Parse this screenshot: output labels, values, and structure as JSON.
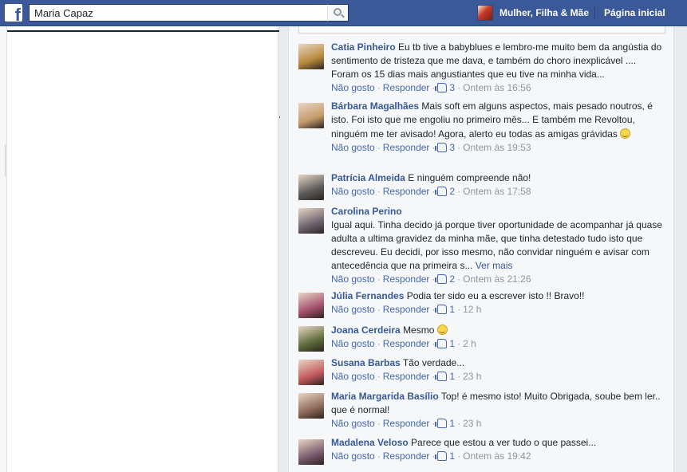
{
  "header": {
    "search_value": "Maria Capaz",
    "page_name": "Mulher, Filha & Mãe",
    "home_label": "Página inicial"
  },
  "actions": {
    "dislike": "Não gosto",
    "reply": "Responder"
  },
  "comments": [
    {
      "author": "Catia Pinheiro",
      "text": "Eu tb tive a babyblues e lembro-me muito bem da angústia do sentimento de tristeza que me dava, e também do choro inexplicável .... Foram os 15 dias mais angustiantes que eu tive na minha vida...",
      "likes": "3",
      "time": "Ontem às 16:56",
      "avatar_color": "#b8893d"
    },
    {
      "author": "Bárbara Magalhães",
      "text": "Mais soft em alguns aspectos, mais pesado noutros, é isto. Foi isto que me engoliu no primeiro mês... E também me Revoltou, ninguém me ter avisado! Agora, alerto eu todas as amigas grávidas",
      "likes": "3",
      "time": "Ontem às 19:53",
      "avatar_color": "#c49a6c"
    },
    {
      "author": "Patrícia Almeida",
      "text": "E ninguém compreende não!",
      "likes": "2",
      "time": "Ontem às 17:58",
      "avatar_color": "#5a5a5a"
    },
    {
      "author": "Carolina Perino",
      "text": "Igual aqui. Tinha decido já porque tiver oportunidade de acompanhar já quase adulta a ultima gravidez da minha mãe, que tinha detestado tudo isto que descreveu. Eu decidi, por isso mesmo, não convidar ninguém e avisar com antecedência que na primeira s...",
      "more": "Ver mais",
      "likes": "2",
      "time": "Ontem às 21:26",
      "avatar_color": "#6d6470"
    },
    {
      "author": "Júlia Fernandes",
      "text": "Podia ter sido eu a escrever isto !! Bravo!!",
      "likes": "1",
      "time": "12 h",
      "avatar_color": "#a4506e"
    },
    {
      "author": "Joana Cerdeira",
      "text": "Mesmo",
      "likes": "1",
      "time": "2 h",
      "avatar_color": "#5d6b3a"
    },
    {
      "author": "Susana Barbas",
      "text": "Tão verdade...",
      "likes": "1",
      "time": "23 h",
      "avatar_color": "#c25a5e"
    },
    {
      "author": "Maria Margarida Basílio",
      "text": "Top! é mesmo isto! Muito Obrigada, soube bem ler.. que é normal!",
      "likes": "1",
      "time": "23 h",
      "avatar_color": "#8e6a5a"
    },
    {
      "author": "Madalena Veloso",
      "text": "Parece que estou a ver tudo o que passei...",
      "likes": "1",
      "time": "Ontem às 19:42",
      "avatar_color": "#7a5a6e"
    }
  ]
}
